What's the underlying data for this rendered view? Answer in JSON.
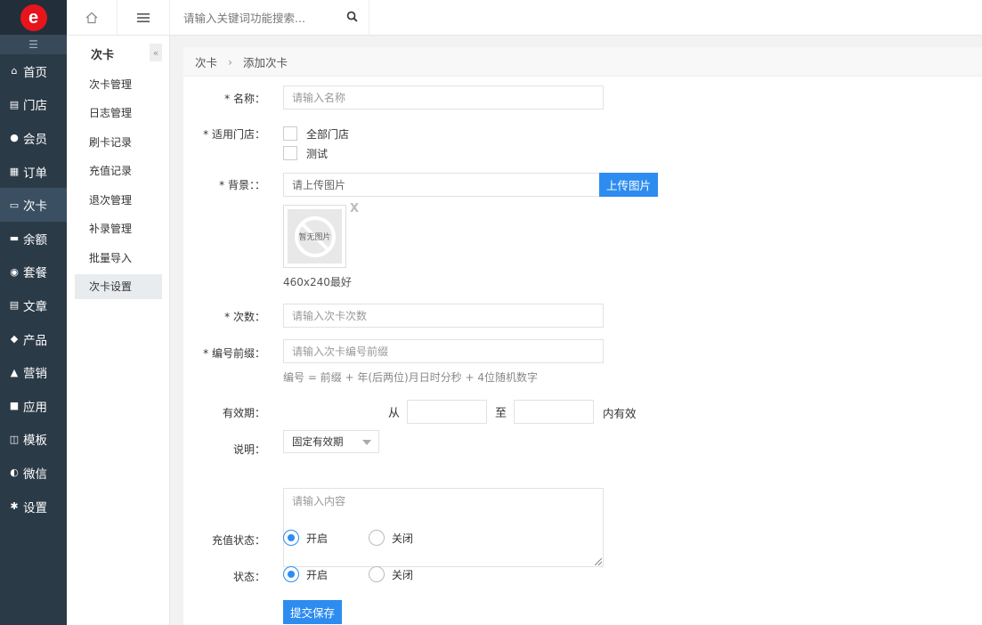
{
  "topbar": {
    "search_placeholder": "请输入关键词功能搜索..."
  },
  "nav": {
    "logo_letter": "e",
    "items": [
      {
        "label": "首页",
        "icon": "home-icon"
      },
      {
        "label": "门店",
        "icon": "store-icon"
      },
      {
        "label": "会员",
        "icon": "user-icon"
      },
      {
        "label": "订单",
        "icon": "order-icon"
      },
      {
        "label": "次卡",
        "icon": "card-icon"
      },
      {
        "label": "余额",
        "icon": "balance-icon"
      },
      {
        "label": "套餐",
        "icon": "package-icon"
      },
      {
        "label": "文章",
        "icon": "article-icon"
      },
      {
        "label": "产品",
        "icon": "tag-icon"
      },
      {
        "label": "营销",
        "icon": "thumbs-up-icon"
      },
      {
        "label": "应用",
        "icon": "grid-icon"
      },
      {
        "label": "模板",
        "icon": "template-icon"
      },
      {
        "label": "微信",
        "icon": "wechat-icon"
      },
      {
        "label": "设置",
        "icon": "gear-icon"
      }
    ],
    "active_index": 4
  },
  "subnav": {
    "title": "次卡",
    "items": [
      "次卡管理",
      "日志管理",
      "刷卡记录",
      "充值记录",
      "退次管理",
      "补录管理",
      "批量导入",
      "次卡设置"
    ],
    "active_index": 7
  },
  "breadcrumb": {
    "parent": "次卡",
    "separator": "›",
    "current": "添加次卡"
  },
  "form": {
    "name_label": "* 名称：",
    "name_placeholder": "请输入名称",
    "stores_label": "* 适用门店：",
    "store_options": [
      "全部门店",
      "测试"
    ],
    "bg_label": "* 背景：：",
    "bg_placeholder": "请上传图片",
    "upload_button": "上传图片",
    "no_image_text": "暂无图片",
    "remove_image": "X",
    "size_hint": "460x240最好",
    "count_label": "* 次数：",
    "count_placeholder": "请输入次卡次数",
    "prefix_label": "* 编号前缀：",
    "prefix_placeholder": "请输入次卡编号前缀",
    "prefix_hint": "编号 = 前缀 + 年(后两位)月日时分秒 + 4位随机数字",
    "validity_label": "有效期：",
    "validity_select": "固定有效期",
    "from_text": "从",
    "to_text": "至",
    "within_text": "内有效",
    "desc_label": "说明：",
    "desc_placeholder": "请输入内容",
    "recharge_label": "充值状态：",
    "status_label": "状态：",
    "on_text": "开启",
    "off_text": "关闭",
    "submit_button": "提交保存"
  }
}
